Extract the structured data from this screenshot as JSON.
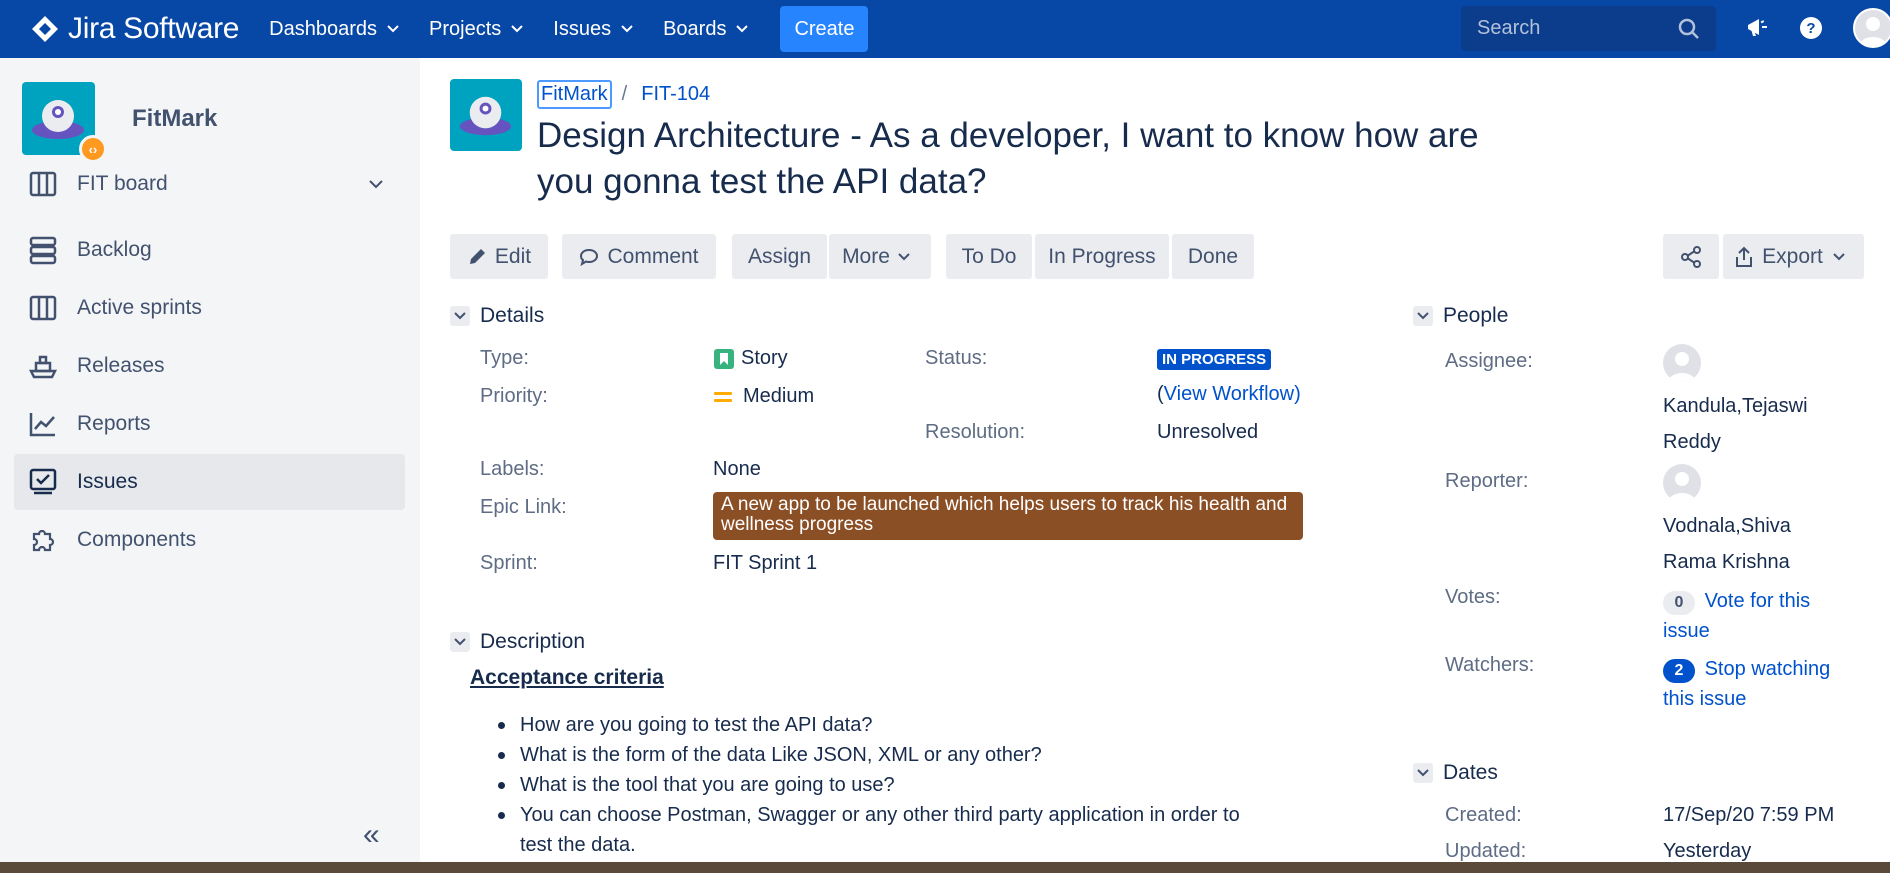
{
  "nav": {
    "brand": "Jira Software",
    "items": [
      "Dashboards",
      "Projects",
      "Issues",
      "Boards"
    ],
    "create": "Create",
    "search_placeholder": "Search"
  },
  "sidebar": {
    "project_name": "FitMark",
    "items": [
      {
        "label": "FIT board",
        "icon": "board-icon"
      },
      {
        "label": "Backlog",
        "icon": "backlog-icon"
      },
      {
        "label": "Active sprints",
        "icon": "sprints-icon"
      },
      {
        "label": "Releases",
        "icon": "ship-icon"
      },
      {
        "label": "Reports",
        "icon": "chart-icon"
      },
      {
        "label": "Issues",
        "icon": "issues-icon"
      },
      {
        "label": "Components",
        "icon": "puzzle-icon"
      }
    ],
    "collapse": "«"
  },
  "issue": {
    "breadcrumb_project": "FitMark",
    "breadcrumb_sep": "/",
    "key": "FIT-104",
    "title": "Design Architecture - As a developer, I want to know how are you gonna test the API data?"
  },
  "toolbar": {
    "edit": "Edit",
    "comment": "Comment",
    "assign": "Assign",
    "more": "More",
    "todo": "To Do",
    "inprogress": "In Progress",
    "done": "Done",
    "export": "Export"
  },
  "details": {
    "heading": "Details",
    "type_label": "Type:",
    "type_value": "Story",
    "priority_label": "Priority:",
    "priority_value": "Medium",
    "status_label": "Status:",
    "status_value": "IN PROGRESS",
    "workflow_open": "(",
    "workflow_link": "View Workflow",
    "workflow_close": ")",
    "resolution_label": "Resolution:",
    "resolution_value": "Unresolved",
    "labels_label": "Labels:",
    "labels_value": "None",
    "epic_label": "Epic Link:",
    "epic_value": "A new app to be launched which helps users to track his health and wellness progress",
    "sprint_label": "Sprint:",
    "sprint_value": "FIT Sprint 1"
  },
  "people": {
    "heading": "People",
    "assignee_label": "Assignee:",
    "assignee_line1": "Kandula,Tejaswi",
    "assignee_line2": "Reddy",
    "reporter_label": "Reporter:",
    "reporter_line1": "Vodnala,Shiva",
    "reporter_line2": "Rama Krishna",
    "votes_label": "Votes:",
    "votes_count": "0",
    "votes_link1": "Vote for this",
    "votes_link2": "issue",
    "watchers_label": "Watchers:",
    "watchers_count": "2",
    "watchers_link1": "Stop watching",
    "watchers_link2": "this issue"
  },
  "dates": {
    "heading": "Dates",
    "created_label": "Created:",
    "created_value": "17/Sep/20 7:59 PM",
    "updated_label": "Updated:",
    "updated_value": "Yesterday"
  },
  "description": {
    "heading": "Description",
    "subheading": "Acceptance criteria",
    "bullets": [
      "How are you going to test the API data?",
      "What is the form of the data Like JSON, XML or any other?",
      "What is the tool that you are going to use?",
      "You can choose Postman, Swagger or any other third party application in order to test the data."
    ]
  },
  "colors": {
    "nav_bg": "#0747a6",
    "accent": "#0052cc",
    "epic": "#8b4f26",
    "sidebar_bg": "#f4f5f7"
  }
}
